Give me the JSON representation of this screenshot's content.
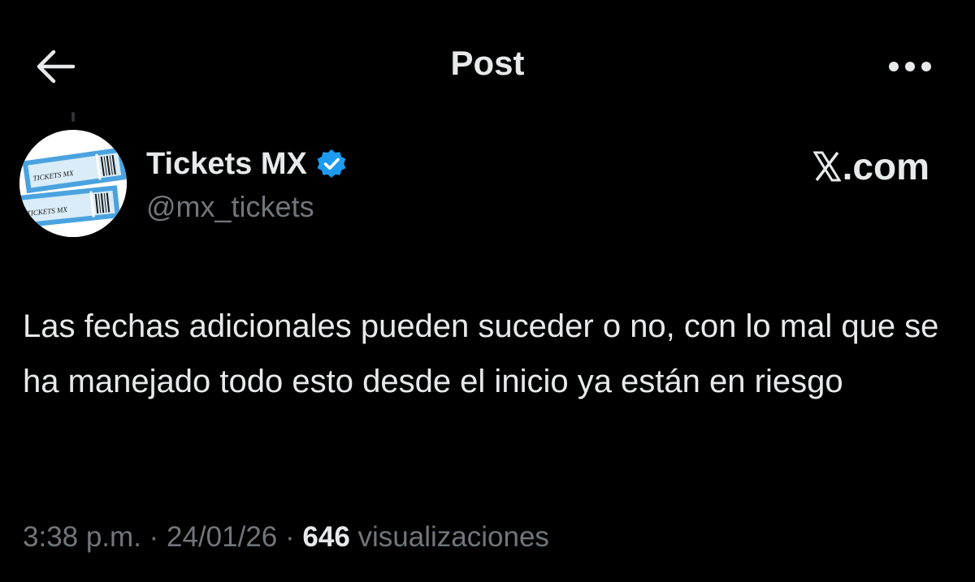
{
  "header": {
    "title": "Post",
    "back_icon": "arrow-left-icon",
    "more_icon": "more-horizontal-icon"
  },
  "author": {
    "name": "Tickets MX",
    "handle": "@mx_tickets",
    "verified": true,
    "verified_color": "#1d9bf0",
    "avatar": {
      "ticket_text_1": "TICKETS MX",
      "ticket_text_2": "TICKETS MX",
      "ticket_color": "#4aa3df"
    }
  },
  "watermark": {
    "text": ".com"
  },
  "post": {
    "text": "Las fechas adicionales pueden suceder o no, con lo mal que se ha manejado todo esto desde el inicio ya están en riesgo"
  },
  "meta": {
    "time": "3:38 p.m.",
    "separator": " · ",
    "date": "24/01/26",
    "views_count": "646",
    "views_label": " visualizaciones"
  },
  "colors": {
    "background": "#000000",
    "primary_text": "#e7e9ea",
    "secondary_text": "#71767b"
  }
}
